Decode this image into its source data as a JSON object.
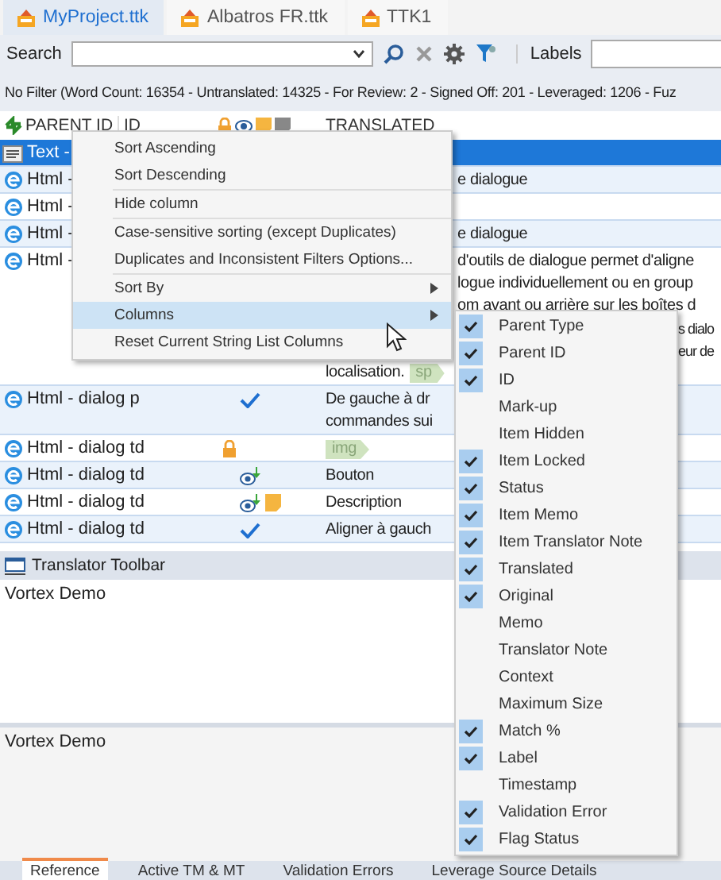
{
  "doc_tabs": [
    {
      "label": "MyProject.ttk",
      "selected": true
    },
    {
      "label": "Albatros FR.ttk",
      "selected": false
    },
    {
      "label": "TTK1",
      "selected": false
    }
  ],
  "search": {
    "label": "Search",
    "labels_label": "Labels"
  },
  "status_line": "No Filter (Word Count: 16354 - Untranslated: 14325 - For Review: 2 - Signed Off: 201 - Leveraged: 1206 - Fuz",
  "grid": {
    "columns": [
      "PARENT ID",
      "ID",
      "TRANSLATED"
    ],
    "rows": [
      {
        "kind": "text",
        "parent_id": "Text -",
        "selected": true,
        "lines": []
      },
      {
        "kind": "html",
        "parent_id": "Html -",
        "selected": false,
        "lines": [
          {
            "kind": "after_menu",
            "text": "e dialogue"
          }
        ]
      },
      {
        "kind": "html",
        "parent_id": "Html -",
        "selected": false,
        "lines": []
      },
      {
        "kind": "html",
        "parent_id": "Html -",
        "selected": false,
        "lines": [
          {
            "kind": "after_menu",
            "text": "e dialogue"
          }
        ]
      },
      {
        "kind": "html",
        "parent_id": "Html -",
        "selected": false,
        "lines": [
          {
            "kind": "after_menu",
            "text": "d'outils de dialogue permet d'aligne"
          },
          {
            "kind": "after_menu",
            "text": "logue individuellement ou en group"
          },
          {
            "kind": "after_menu",
            "text": "om avant ou arrière sur les boîtes d"
          },
          {
            "kind": "after_submenu",
            "text": "s dialo"
          },
          {
            "kind": "after_submenu",
            "text": "eur de"
          },
          {
            "kind": "plain",
            "text": "localisation.",
            "tag": "sp"
          }
        ]
      },
      {
        "kind": "html",
        "parent_id": "Html - dialog p",
        "selected": false,
        "confirmed": true,
        "locked": false,
        "reviewed": false,
        "memo": false,
        "lines": [
          {
            "kind": "plain",
            "text": "De gauche à dr"
          },
          {
            "kind": "plain",
            "text": "commandes sui"
          }
        ]
      },
      {
        "kind": "html",
        "parent_id": "Html - dialog td",
        "selected": false,
        "confirmed": false,
        "locked": true,
        "reviewed": false,
        "memo": false,
        "lines": [
          {
            "kind": "plain",
            "tag": "img"
          }
        ]
      },
      {
        "kind": "html",
        "parent_id": "Html - dialog td",
        "selected": false,
        "confirmed": false,
        "locked": false,
        "reviewed": true,
        "memo": false,
        "lines": [
          {
            "kind": "plain",
            "text": "Bouton"
          }
        ]
      },
      {
        "kind": "html",
        "parent_id": "Html - dialog td",
        "selected": false,
        "confirmed": false,
        "locked": false,
        "reviewed": true,
        "memo": true,
        "lines": [
          {
            "kind": "plain",
            "text": "Description"
          }
        ]
      },
      {
        "kind": "html",
        "parent_id": "Html - dialog td",
        "selected": false,
        "confirmed": true,
        "locked": false,
        "reviewed": false,
        "memo": false,
        "lines": [
          {
            "kind": "plain",
            "text": "Aligner à gauch"
          }
        ]
      }
    ]
  },
  "translator_toolbar": {
    "title": "Translator Toolbar",
    "source": "Vortex Demo",
    "target": "Vortex Demo"
  },
  "bottom_tabs": [
    {
      "label": "Reference",
      "selected": true
    },
    {
      "label": "Active TM & MT",
      "selected": false
    },
    {
      "label": "Validation Errors",
      "selected": false
    },
    {
      "label": "Leverage Source Details",
      "selected": false
    }
  ],
  "context_menu": {
    "items": [
      {
        "kind": "item",
        "label": "Sort Ascending",
        "highlighted": false
      },
      {
        "kind": "item",
        "label": "Sort Descending",
        "highlighted": false
      },
      {
        "kind": "separator"
      },
      {
        "kind": "item",
        "label": "Hide column",
        "highlighted": false
      },
      {
        "kind": "separator"
      },
      {
        "kind": "item",
        "label": "Case-sensitive sorting (except Duplicates)",
        "highlighted": false
      },
      {
        "kind": "item",
        "label": "Duplicates and Inconsistent Filters Options...",
        "highlighted": false
      },
      {
        "kind": "separator"
      },
      {
        "kind": "submenu",
        "label": "Sort By",
        "highlighted": false
      },
      {
        "kind": "submenu",
        "label": "Columns",
        "highlighted": true
      },
      {
        "kind": "item",
        "label": "Reset Current String List Columns",
        "highlighted": false
      }
    ]
  },
  "columns_menu": [
    {
      "label": "Parent Type",
      "checked": true
    },
    {
      "label": "Parent ID",
      "checked": true
    },
    {
      "label": "ID",
      "checked": true
    },
    {
      "label": "Mark-up",
      "checked": false
    },
    {
      "label": "Item Hidden",
      "checked": false
    },
    {
      "label": "Item Locked",
      "checked": true
    },
    {
      "label": "Status",
      "checked": true
    },
    {
      "label": "Item Memo",
      "checked": true
    },
    {
      "label": "Item Translator Note",
      "checked": true
    },
    {
      "label": "Translated",
      "checked": true
    },
    {
      "label": "Original",
      "checked": true
    },
    {
      "label": "Memo",
      "checked": false
    },
    {
      "label": "Translator Note",
      "checked": false
    },
    {
      "label": "Context",
      "checked": false
    },
    {
      "label": "Maximum Size",
      "checked": false
    },
    {
      "label": "Match %",
      "checked": true
    },
    {
      "label": "Label",
      "checked": true
    },
    {
      "label": "Timestamp",
      "checked": false
    },
    {
      "label": "Validation Error",
      "checked": true
    },
    {
      "label": "Flag Status",
      "checked": true
    }
  ]
}
